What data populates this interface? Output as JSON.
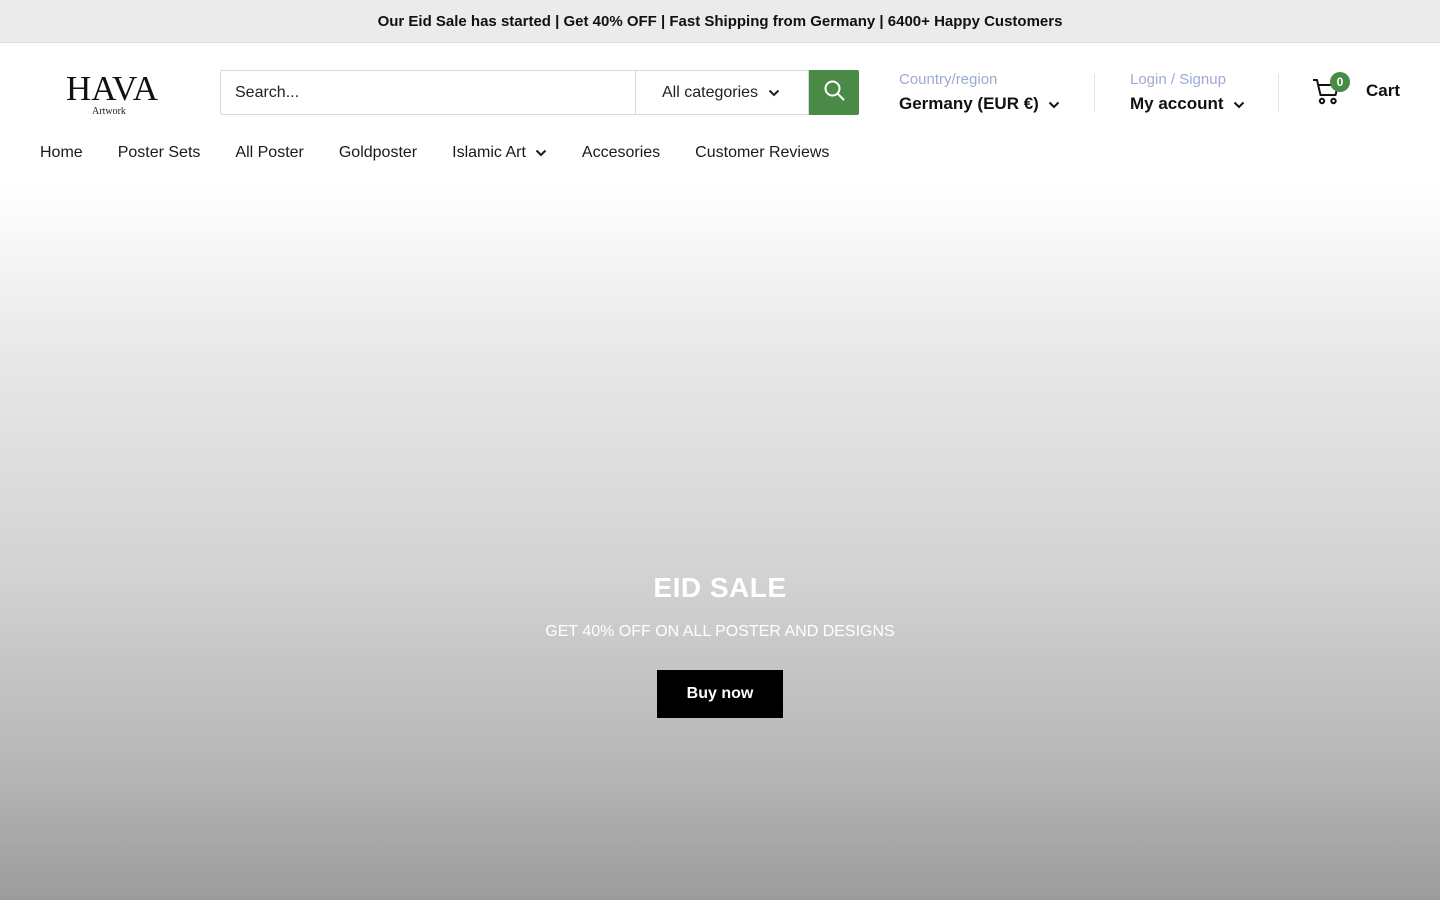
{
  "announcement": {
    "text": "Our Eid Sale has started | Get 40% OFF | Fast Shipping from Germany | 6400+ Happy Customers"
  },
  "logo": {
    "main": "HAVA",
    "sub": "Artwork"
  },
  "search": {
    "placeholder": "Search...",
    "category": "All categories",
    "icon": "search-icon"
  },
  "country": {
    "label": "Country/region",
    "value": "Germany (EUR €)"
  },
  "account": {
    "label": "Login / Signup",
    "value": "My account"
  },
  "cart": {
    "count": "0",
    "label": "Cart"
  },
  "nav": {
    "items": [
      {
        "label": "Home"
      },
      {
        "label": "Poster Sets"
      },
      {
        "label": "All Poster"
      },
      {
        "label": "Goldposter"
      },
      {
        "label": "Islamic Art"
      },
      {
        "label": "Accesories"
      },
      {
        "label": "Customer Reviews"
      }
    ]
  },
  "hero": {
    "title": "EID SALE",
    "subtitle": "GET 40% OFF ON ALL POSTER AND DESIGNS",
    "button": "Buy now"
  },
  "colors": {
    "accent": "#4a8a47",
    "muted_label": "#9ea8d6",
    "announcement_bg": "#ebebeb",
    "button_bg": "#000000"
  }
}
